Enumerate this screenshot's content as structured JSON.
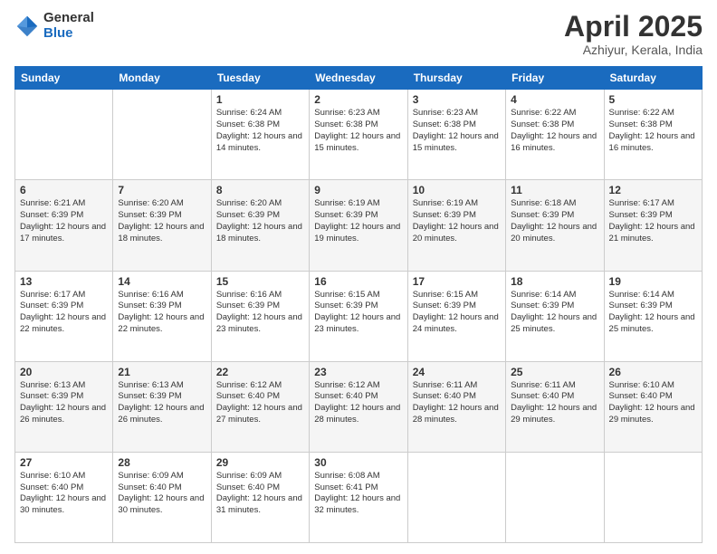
{
  "header": {
    "logo_general": "General",
    "logo_blue": "Blue",
    "title": "April 2025",
    "subtitle": "Azhiyur, Kerala, India"
  },
  "weekdays": [
    "Sunday",
    "Monday",
    "Tuesday",
    "Wednesday",
    "Thursday",
    "Friday",
    "Saturday"
  ],
  "weeks": [
    [
      {
        "day": "",
        "info": ""
      },
      {
        "day": "",
        "info": ""
      },
      {
        "day": "1",
        "info": "Sunrise: 6:24 AM\nSunset: 6:38 PM\nDaylight: 12 hours and 14 minutes."
      },
      {
        "day": "2",
        "info": "Sunrise: 6:23 AM\nSunset: 6:38 PM\nDaylight: 12 hours and 15 minutes."
      },
      {
        "day": "3",
        "info": "Sunrise: 6:23 AM\nSunset: 6:38 PM\nDaylight: 12 hours and 15 minutes."
      },
      {
        "day": "4",
        "info": "Sunrise: 6:22 AM\nSunset: 6:38 PM\nDaylight: 12 hours and 16 minutes."
      },
      {
        "day": "5",
        "info": "Sunrise: 6:22 AM\nSunset: 6:38 PM\nDaylight: 12 hours and 16 minutes."
      }
    ],
    [
      {
        "day": "6",
        "info": "Sunrise: 6:21 AM\nSunset: 6:39 PM\nDaylight: 12 hours and 17 minutes."
      },
      {
        "day": "7",
        "info": "Sunrise: 6:20 AM\nSunset: 6:39 PM\nDaylight: 12 hours and 18 minutes."
      },
      {
        "day": "8",
        "info": "Sunrise: 6:20 AM\nSunset: 6:39 PM\nDaylight: 12 hours and 18 minutes."
      },
      {
        "day": "9",
        "info": "Sunrise: 6:19 AM\nSunset: 6:39 PM\nDaylight: 12 hours and 19 minutes."
      },
      {
        "day": "10",
        "info": "Sunrise: 6:19 AM\nSunset: 6:39 PM\nDaylight: 12 hours and 20 minutes."
      },
      {
        "day": "11",
        "info": "Sunrise: 6:18 AM\nSunset: 6:39 PM\nDaylight: 12 hours and 20 minutes."
      },
      {
        "day": "12",
        "info": "Sunrise: 6:17 AM\nSunset: 6:39 PM\nDaylight: 12 hours and 21 minutes."
      }
    ],
    [
      {
        "day": "13",
        "info": "Sunrise: 6:17 AM\nSunset: 6:39 PM\nDaylight: 12 hours and 22 minutes."
      },
      {
        "day": "14",
        "info": "Sunrise: 6:16 AM\nSunset: 6:39 PM\nDaylight: 12 hours and 22 minutes."
      },
      {
        "day": "15",
        "info": "Sunrise: 6:16 AM\nSunset: 6:39 PM\nDaylight: 12 hours and 23 minutes."
      },
      {
        "day": "16",
        "info": "Sunrise: 6:15 AM\nSunset: 6:39 PM\nDaylight: 12 hours and 23 minutes."
      },
      {
        "day": "17",
        "info": "Sunrise: 6:15 AM\nSunset: 6:39 PM\nDaylight: 12 hours and 24 minutes."
      },
      {
        "day": "18",
        "info": "Sunrise: 6:14 AM\nSunset: 6:39 PM\nDaylight: 12 hours and 25 minutes."
      },
      {
        "day": "19",
        "info": "Sunrise: 6:14 AM\nSunset: 6:39 PM\nDaylight: 12 hours and 25 minutes."
      }
    ],
    [
      {
        "day": "20",
        "info": "Sunrise: 6:13 AM\nSunset: 6:39 PM\nDaylight: 12 hours and 26 minutes."
      },
      {
        "day": "21",
        "info": "Sunrise: 6:13 AM\nSunset: 6:39 PM\nDaylight: 12 hours and 26 minutes."
      },
      {
        "day": "22",
        "info": "Sunrise: 6:12 AM\nSunset: 6:40 PM\nDaylight: 12 hours and 27 minutes."
      },
      {
        "day": "23",
        "info": "Sunrise: 6:12 AM\nSunset: 6:40 PM\nDaylight: 12 hours and 28 minutes."
      },
      {
        "day": "24",
        "info": "Sunrise: 6:11 AM\nSunset: 6:40 PM\nDaylight: 12 hours and 28 minutes."
      },
      {
        "day": "25",
        "info": "Sunrise: 6:11 AM\nSunset: 6:40 PM\nDaylight: 12 hours and 29 minutes."
      },
      {
        "day": "26",
        "info": "Sunrise: 6:10 AM\nSunset: 6:40 PM\nDaylight: 12 hours and 29 minutes."
      }
    ],
    [
      {
        "day": "27",
        "info": "Sunrise: 6:10 AM\nSunset: 6:40 PM\nDaylight: 12 hours and 30 minutes."
      },
      {
        "day": "28",
        "info": "Sunrise: 6:09 AM\nSunset: 6:40 PM\nDaylight: 12 hours and 30 minutes."
      },
      {
        "day": "29",
        "info": "Sunrise: 6:09 AM\nSunset: 6:40 PM\nDaylight: 12 hours and 31 minutes."
      },
      {
        "day": "30",
        "info": "Sunrise: 6:08 AM\nSunset: 6:41 PM\nDaylight: 12 hours and 32 minutes."
      },
      {
        "day": "",
        "info": ""
      },
      {
        "day": "",
        "info": ""
      },
      {
        "day": "",
        "info": ""
      }
    ]
  ]
}
